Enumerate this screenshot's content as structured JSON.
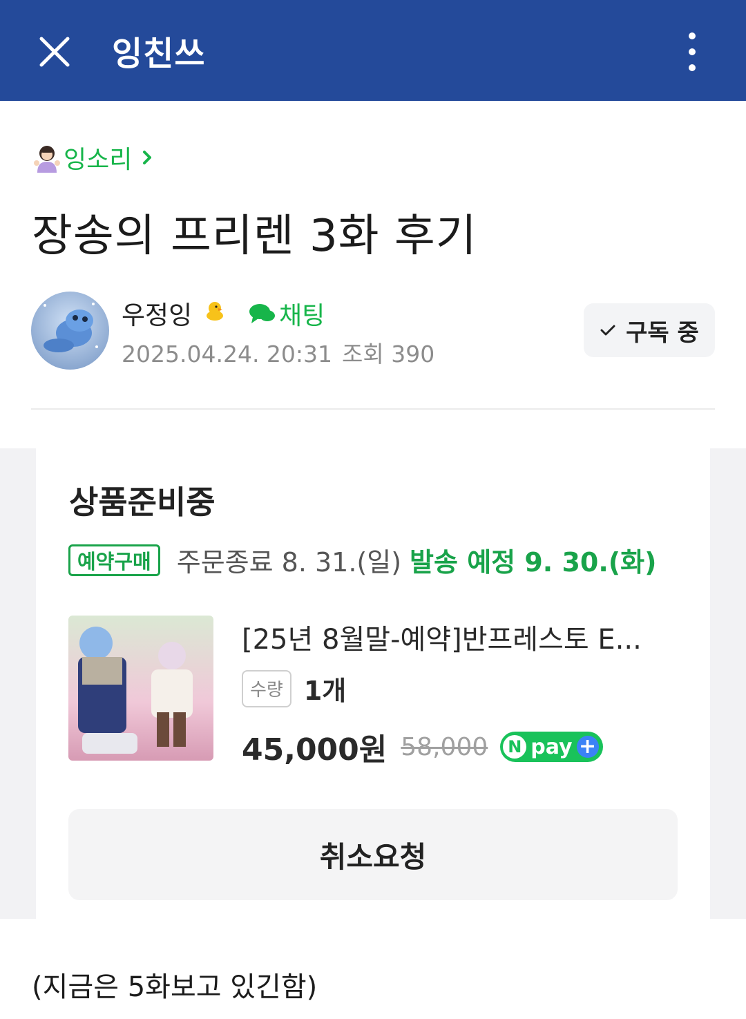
{
  "header": {
    "title": "잉친쓰",
    "background_color": "#244a9a"
  },
  "post": {
    "category": "잉소리",
    "title": "장송의 프리렌 3화 후기",
    "author": {
      "name": "우정잉",
      "chat_label": "채팅",
      "date": "2025.04.24. 20:31",
      "views_label": "조회 390"
    },
    "subscribe_label": "구독 중",
    "body_text": "(지금은 5화보고 있긴함)"
  },
  "product_card": {
    "status_title": "상품준비중",
    "reserve_badge": "예약구매",
    "order_end": "주문종료 8. 31.(일)",
    "shipping": "발송 예정 9. 30.(화)",
    "product_name": "[25년 8월말-예약]반프레스토 E...",
    "qty_label": "수량",
    "qty_value": "1개",
    "price": "45,000원",
    "original_price": "58,000",
    "npay_label": "pay",
    "cancel_button": "취소요청"
  },
  "colors": {
    "accent_green": "#17b54a",
    "npay_green": "#19c25a"
  }
}
